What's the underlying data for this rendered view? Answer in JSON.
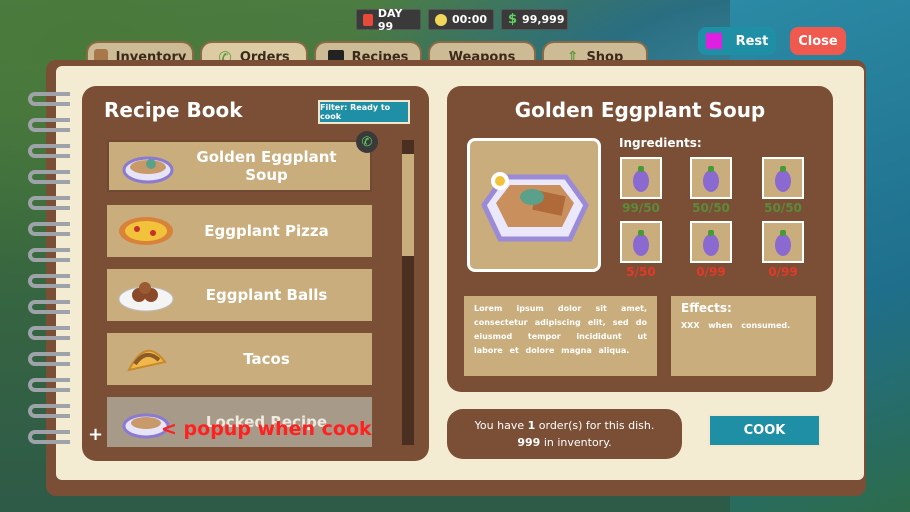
{
  "hud": {
    "day": "DAY 99",
    "time": "00:00",
    "money": "99,999"
  },
  "tabs": [
    {
      "label": "Inventory"
    },
    {
      "label": "Orders"
    },
    {
      "label": "Recipes"
    },
    {
      "label": "Weapons"
    },
    {
      "label": "Shop"
    }
  ],
  "top_buttons": {
    "rest": "Rest",
    "close": "Close"
  },
  "recipe_book": {
    "title": "Recipe Book",
    "filter": "Filter: Ready to cook",
    "items": [
      {
        "label": "Golden Eggplant Soup"
      },
      {
        "label": "Eggplant Pizza"
      },
      {
        "label": "Eggplant Balls"
      },
      {
        "label": "Tacos"
      },
      {
        "label": "Locked Recipe"
      }
    ]
  },
  "detail": {
    "title": "Golden Eggplant Soup",
    "ingredients_label": "Ingredients:",
    "ingredients": [
      {
        "count": "99/50",
        "color": "#5b8a3a"
      },
      {
        "count": "50/50",
        "color": "#5b8a3a"
      },
      {
        "count": "50/50",
        "color": "#5b8a3a"
      },
      {
        "count": "5/50",
        "color": "#e03a2a"
      },
      {
        "count": "0/99",
        "color": "#e03a2a"
      },
      {
        "count": "0/99",
        "color": "#e03a2a"
      }
    ],
    "description": "Lorem ipsum dolor sit amet, consectetur adipiscing elit, sed do eiusmod tempor incididunt ut labore et dolore magna aliqua.",
    "effects_title": "Effects:",
    "effects_text": "XXX when consumed."
  },
  "orders": {
    "line1_pre": "You have ",
    "line1_num": "1",
    "line1_post": " order(s) for this dish.",
    "line2_num": "999",
    "line2_post": " in inventory."
  },
  "cook": "COOK",
  "annotation": {
    "plus": "+",
    "text": "< popup when cook"
  }
}
